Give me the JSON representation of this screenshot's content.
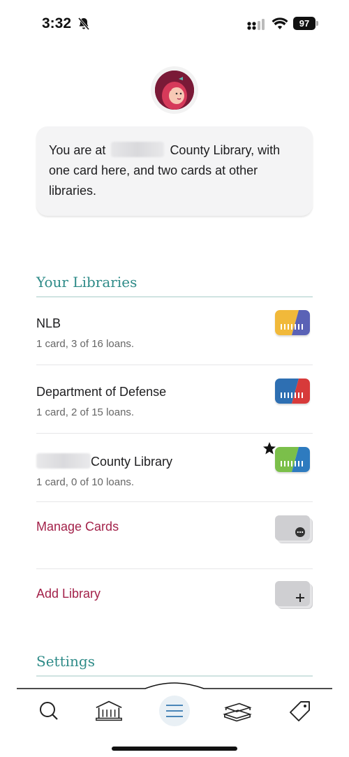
{
  "status_bar": {
    "time": "3:32",
    "battery": "97"
  },
  "summary": {
    "prefix": "You are at",
    "suffix": "County Library, with one card here, and two cards at other libraries."
  },
  "your_libraries": {
    "heading": "Your Libraries",
    "items": [
      {
        "name": "NLB",
        "detail": "1 card, 3 of 16 loans.",
        "card_colors": [
          "#f1b93a",
          "#5a62b6"
        ],
        "starred": false
      },
      {
        "name": "Department of Defense",
        "detail": "1 card, 2 of 15 loans.",
        "card_colors": [
          "#2e6fb2",
          "#d73a3a"
        ],
        "starred": false
      },
      {
        "name": "County Library",
        "detail": "1 card, 0 of 10 loans.",
        "card_colors": [
          "#7bbf4a",
          "#2e7bbf"
        ],
        "starred": true
      }
    ],
    "manage_cards": "Manage Cards",
    "add_library": "Add Library"
  },
  "settings": {
    "heading": "Settings"
  },
  "tab_bar": {
    "tabs": [
      "search",
      "library",
      "menu",
      "shelf",
      "tags"
    ],
    "active": "menu"
  },
  "colors": {
    "accent_teal": "#2e8b88",
    "accent_red": "#a3224a",
    "active_tab": "#4a86b8"
  }
}
